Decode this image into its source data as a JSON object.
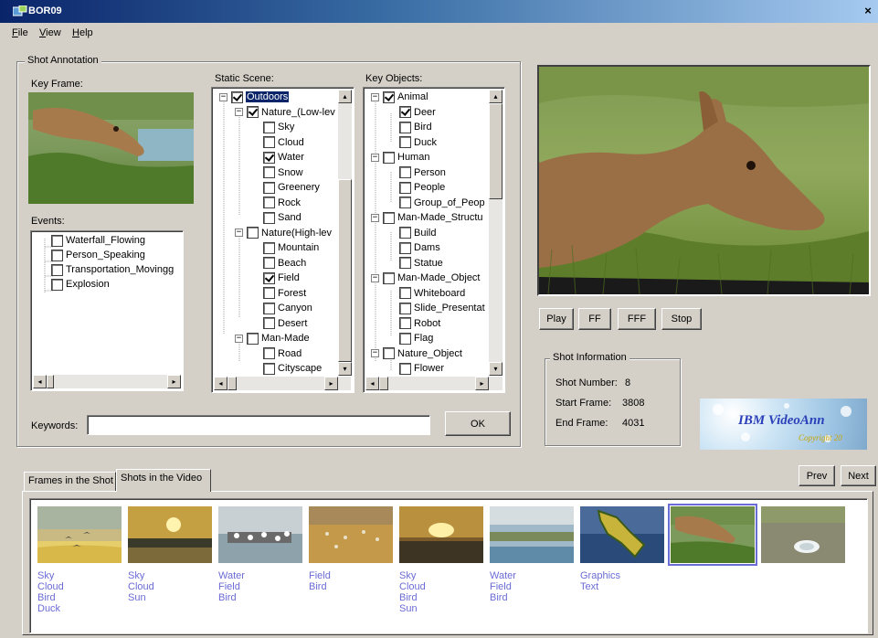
{
  "window": {
    "title": "BOR09",
    "close_glyph": "×"
  },
  "menu": {
    "file": "File",
    "view": "View",
    "help": "Help"
  },
  "shot_annotation": {
    "group_label": "Shot Annotation",
    "key_frame_label": "Key Frame:",
    "events_label": "Events:",
    "events": [
      "Waterfall_Flowing",
      "Person_Speaking",
      "Transportation_Movingg",
      "Explosion"
    ],
    "static_scene_label": "Static Scene:",
    "static_scene": [
      {
        "label": "Outdoors",
        "level": 0,
        "exp": "−",
        "checked": true,
        "selected": true
      },
      {
        "label": "Nature_(Low-lev",
        "level": 1,
        "exp": "−",
        "checked": true
      },
      {
        "label": "Sky",
        "level": 2,
        "checked": false
      },
      {
        "label": "Cloud",
        "level": 2,
        "checked": false
      },
      {
        "label": "Water",
        "level": 2,
        "checked": true
      },
      {
        "label": "Snow",
        "level": 2,
        "checked": false
      },
      {
        "label": "Greenery",
        "level": 2,
        "checked": false
      },
      {
        "label": "Rock",
        "level": 2,
        "checked": false
      },
      {
        "label": "Sand",
        "level": 2,
        "checked": false
      },
      {
        "label": "Nature(High-lev",
        "level": 1,
        "exp": "−",
        "checked": false
      },
      {
        "label": "Mountain",
        "level": 2,
        "checked": false
      },
      {
        "label": "Beach",
        "level": 2,
        "checked": false
      },
      {
        "label": "Field",
        "level": 2,
        "checked": true
      },
      {
        "label": "Forest",
        "level": 2,
        "checked": false
      },
      {
        "label": "Canyon",
        "level": 2,
        "checked": false
      },
      {
        "label": "Desert",
        "level": 2,
        "checked": false
      },
      {
        "label": "Man-Made",
        "level": 1,
        "exp": "−",
        "checked": false
      },
      {
        "label": "Road",
        "level": 2,
        "checked": false
      },
      {
        "label": "Cityscape",
        "level": 2,
        "checked": false
      }
    ],
    "key_objects_label": "Key Objects:",
    "key_objects": [
      {
        "label": "Animal",
        "level": 0,
        "exp": "−",
        "checked": true
      },
      {
        "label": "Deer",
        "level": 1,
        "checked": true
      },
      {
        "label": "Bird",
        "level": 1,
        "checked": false
      },
      {
        "label": "Duck",
        "level": 1,
        "checked": false
      },
      {
        "label": "Human",
        "level": 0,
        "exp": "−",
        "checked": false
      },
      {
        "label": "Person",
        "level": 1,
        "checked": false
      },
      {
        "label": "People",
        "level": 1,
        "checked": false
      },
      {
        "label": "Group_of_Peop",
        "level": 1,
        "checked": false
      },
      {
        "label": "Man-Made_Structu",
        "level": 0,
        "exp": "−",
        "checked": false
      },
      {
        "label": "Build",
        "level": 1,
        "checked": false
      },
      {
        "label": "Dams",
        "level": 1,
        "checked": false
      },
      {
        "label": "Statue",
        "level": 1,
        "checked": false
      },
      {
        "label": "Man-Made_Object",
        "level": 0,
        "exp": "−",
        "checked": false
      },
      {
        "label": "Whiteboard",
        "level": 1,
        "checked": false
      },
      {
        "label": "Slide_Presentat",
        "level": 1,
        "checked": false
      },
      {
        "label": "Robot",
        "level": 1,
        "checked": false
      },
      {
        "label": "Flag",
        "level": 1,
        "checked": false
      },
      {
        "label": "Nature_Object",
        "level": 0,
        "exp": "−",
        "checked": false
      },
      {
        "label": "Flower",
        "level": 1,
        "checked": false
      }
    ],
    "keywords_label": "Keywords:",
    "keywords_value": "",
    "ok_label": "OK"
  },
  "player": {
    "play": "Play",
    "ff": "FF",
    "fff": "FFF",
    "stop": "Stop"
  },
  "shot_info": {
    "group_label": "Shot Information",
    "shot_number_label": "Shot Number:",
    "shot_number": "8",
    "start_frame_label": "Start Frame:",
    "start_frame": "3808",
    "end_frame_label": "End Frame:",
    "end_frame": "4031"
  },
  "logo": {
    "text": "IBM VideoAnn",
    "copyright": "Copyright 20"
  },
  "tabs": {
    "frames": "Frames in the Shot",
    "shots": "Shots in the Video"
  },
  "nav": {
    "prev": "Prev",
    "next": "Next"
  },
  "shots": [
    {
      "tags": [
        "Sky",
        "Cloud",
        "Bird",
        "Duck"
      ],
      "scene": "sunset-birds"
    },
    {
      "tags": [
        "Sky",
        "Cloud",
        "Sun"
      ],
      "scene": "sunset"
    },
    {
      "tags": [
        "Water",
        "Field",
        "Bird"
      ],
      "scene": "birds-flock"
    },
    {
      "tags": [
        "Field",
        "Bird"
      ],
      "scene": "field-birds"
    },
    {
      "tags": [
        "Sky",
        "Cloud",
        "Bird",
        "Sun"
      ],
      "scene": "sunset2"
    },
    {
      "tags": [
        "Water",
        "Field",
        "Bird"
      ],
      "scene": "water-field"
    },
    {
      "tags": [
        "Graphics",
        "Text"
      ],
      "scene": "map"
    },
    {
      "tags": [],
      "scene": "deer",
      "selected": true
    },
    {
      "tags": [],
      "scene": "splash"
    }
  ]
}
